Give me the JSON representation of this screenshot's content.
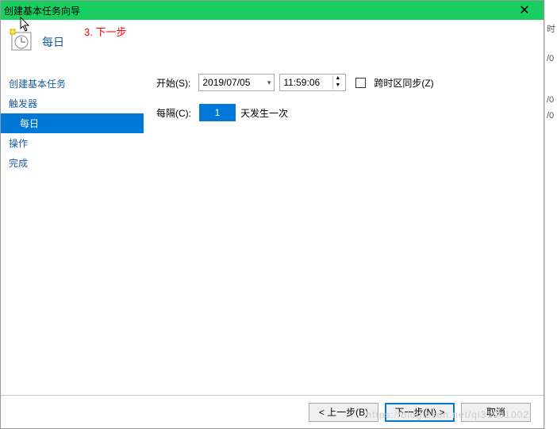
{
  "titlebar": {
    "title": "创建基本任务向导",
    "close": "✕"
  },
  "header": {
    "heading": "每日",
    "annotation": "3. 下一步"
  },
  "sidebar": {
    "items": [
      {
        "label": "创建基本任务"
      },
      {
        "label": "触发器"
      },
      {
        "label": "每日"
      },
      {
        "label": "操作"
      },
      {
        "label": "完成"
      }
    ]
  },
  "content": {
    "start_label": "开始(S):",
    "date_value": "2019/07/05",
    "time_value": "11:59:06",
    "sync_label": "跨时区同步(Z)",
    "recur_label": "每隔(C):",
    "recur_value": "1",
    "recur_suffix": "天发生一次"
  },
  "footer": {
    "back": "< 上一步(B)",
    "next": "下一步(N) >",
    "cancel": "取消"
  },
  "rightstrip": {
    "t1": "时",
    "t2": "/0",
    "t3": "/0",
    "t4": "/0"
  },
  "watermark": "https://blog.csdn.net/ql31001002"
}
